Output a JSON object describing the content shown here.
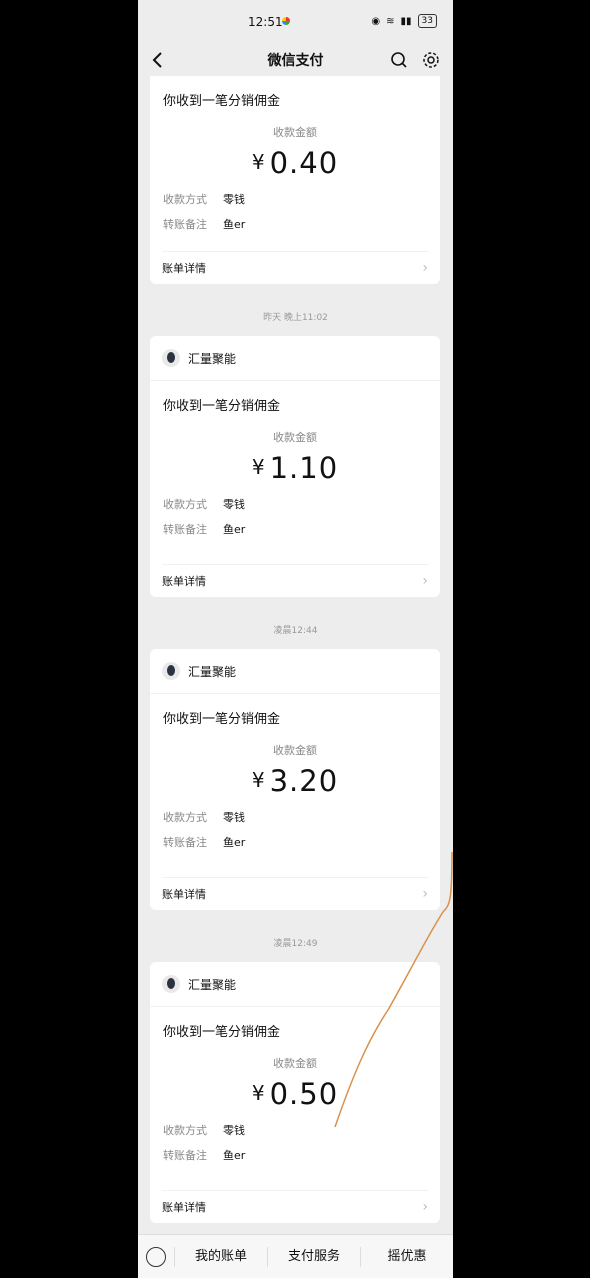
{
  "status": {
    "time": "12:51",
    "battery": "33"
  },
  "nav": {
    "title": "微信支付"
  },
  "cards": [
    {
      "sender": "",
      "subtitle": "你收到一笔分销佣金",
      "amount_label": "收款金额",
      "currency": "¥",
      "amount": "0.40",
      "method_key": "收款方式",
      "method_val": "零钱",
      "note_key": "转账备注",
      "note_val": "鱼er",
      "footer": "账单详情"
    },
    {
      "sender": "汇量聚能",
      "subtitle": "你收到一笔分销佣金",
      "amount_label": "收款金额",
      "currency": "¥",
      "amount": "1.10",
      "method_key": "收款方式",
      "method_val": "零钱",
      "note_key": "转账备注",
      "note_val": "鱼er",
      "footer": "账单详情"
    },
    {
      "sender": "汇量聚能",
      "subtitle": "你收到一笔分销佣金",
      "amount_label": "收款金额",
      "currency": "¥",
      "amount": "3.20",
      "method_key": "收款方式",
      "method_val": "零钱",
      "note_key": "转账备注",
      "note_val": "鱼er",
      "footer": "账单详情"
    },
    {
      "sender": "汇量聚能",
      "subtitle": "你收到一笔分销佣金",
      "amount_label": "收款金额",
      "currency": "¥",
      "amount": "0.50",
      "method_key": "收款方式",
      "method_val": "零钱",
      "note_key": "转账备注",
      "note_val": "鱼er",
      "footer": "账单详情"
    }
  ],
  "timestamps": [
    "昨天 晚上11:02",
    "凌晨12:44",
    "凌晨12:49"
  ],
  "bottom": {
    "tab1": "我的账单",
    "tab2": "支付服务",
    "tab3": "摇优惠"
  },
  "colors": {
    "scribble": "#d9904a"
  }
}
